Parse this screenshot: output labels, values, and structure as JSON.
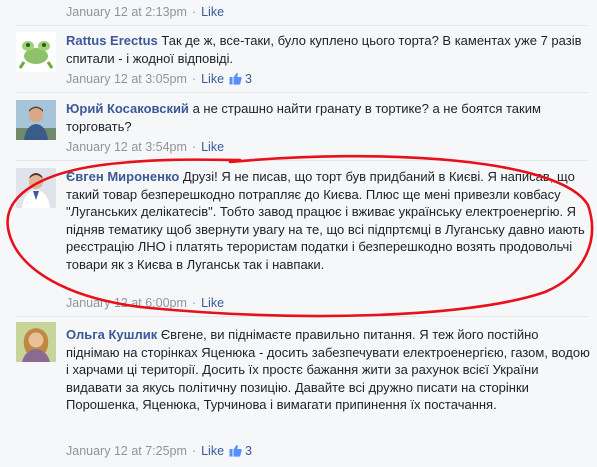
{
  "comments": [
    {
      "meta_time": "January 12 at 2:13pm",
      "like_label": "Like"
    },
    {
      "author": "Rattus Erectus",
      "text": "Так де ж, все-таки, було куплено цього торта? В каментах уже 7 разів спитали - і жодної відповіді.",
      "meta_time": "January 12 at 3:05pm",
      "like_label": "Like",
      "like_count": "3"
    },
    {
      "author": "Юрий Косаковский",
      "text": "а не страшно найти гранату в тортике? а не боятся таким торговать?",
      "meta_time": "January 12 at 3:54pm",
      "like_label": "Like"
    },
    {
      "author": "Євген Мироненко",
      "text": "Друзі! Я не писав, що торт був придбаний в Києві. Я написав, що такий товар безперешкодно потрапляє до Києва. Плюс ще мені привезли ковбасу \"Луганських делікатесів\". Тобто завод працює і вживає українську електроенергію. Я підняв тематику щоб звернути увагу на те, що всі підпртємці в Луганську давно иають реєстрацію ЛНО і платять терористам податки і безперешкодно возять продовольчі товари як з Києва в Луганськ так і навпаки.",
      "meta_time": "January 12 at 6:00pm",
      "like_label": "Like"
    },
    {
      "author": "Ольга Кушлик",
      "text": "Євгене, ви піднімаєте правильно питання. Я теж його постійно піднімаю на сторінках Яценюка - досить забезпечувати електроенергією, газом, водою і харчами ці території. Досить їх простє бажання жити за рахунок всієї України видавати за якусь політичну позицію. Давайте всі дружно писати на сторінки Порошенка, Яценюка, Турчинова і вимагати припинення їх постачання.",
      "meta_time": "January 12 at 7:25pm",
      "like_label": "Like",
      "like_count": "3"
    }
  ],
  "colors": {
    "link": "#3b5998",
    "meta": "#90949c",
    "background": "#f6f7f9",
    "annotation_ellipse": "#e8101a"
  }
}
